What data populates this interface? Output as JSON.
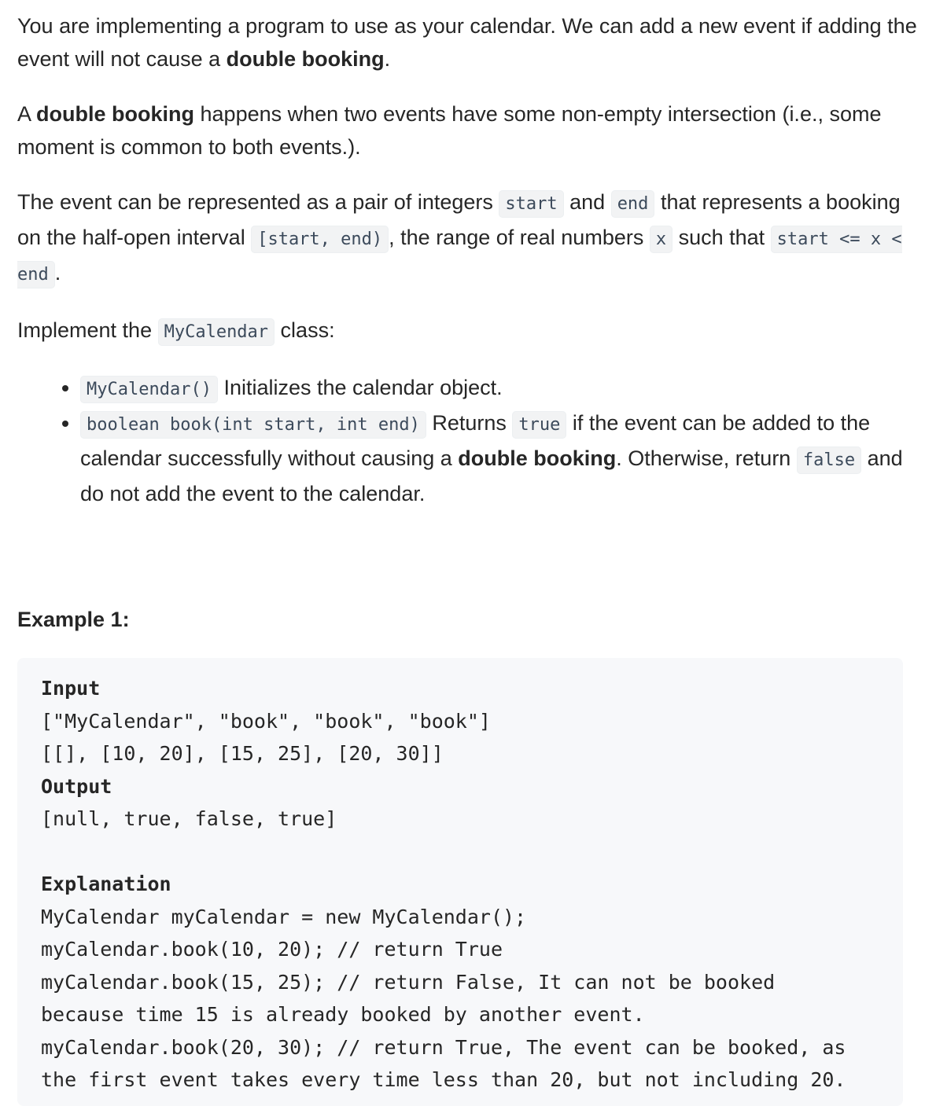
{
  "para1": {
    "text": "You are implementing a program to use as your calendar. We can add a new event if adding the event will not cause a ",
    "bold": "double booking",
    "end": "."
  },
  "para2": {
    "prefix": "A ",
    "bold": "double booking",
    "text": " happens when two events have some non-empty intersection (i.e., some moment is common to both events.)."
  },
  "para3": {
    "t1": "The event can be represented as a pair of integers ",
    "c1": "start",
    "t2": " and ",
    "c2": "end",
    "t3": " that represents a booking on the half-open interval ",
    "c3": "[start, end)",
    "t4": ", the range of real numbers ",
    "c4": "x",
    "t5": " such that ",
    "c5": "start <= x < end",
    "t6": "."
  },
  "para4": {
    "t1": "Implement the ",
    "c1": "MyCalendar",
    "t2": " class:"
  },
  "bullets": {
    "b1": {
      "code": "MyCalendar()",
      "text": " Initializes the calendar object."
    },
    "b2": {
      "code": "boolean book(int start, int end)",
      "t1": " Returns ",
      "c2": "true",
      "t2": " if the event can be added to the calendar successfully without causing a ",
      "bold": "double booking",
      "t3": ". Otherwise, return ",
      "c3": "false",
      "t4": " and do not add the event to the calendar."
    }
  },
  "example": {
    "heading": "Example 1:",
    "input_label": "Input",
    "input_line1": "[\"MyCalendar\", \"book\", \"book\", \"book\"]",
    "input_line2": "[[], [10, 20], [15, 25], [20, 30]]",
    "output_label": "Output",
    "output_line": "[null, true, false, true]",
    "explanation_label": "Explanation",
    "exp_lines": [
      "MyCalendar myCalendar = new MyCalendar();",
      "myCalendar.book(10, 20); // return True",
      "myCalendar.book(15, 25); // return False, It can not be booked",
      "because time 15 is already booked by another event.",
      "myCalendar.book(20, 30); // return True, The event can be booked, as",
      "the first event takes every time less than 20, but not including 20."
    ]
  }
}
